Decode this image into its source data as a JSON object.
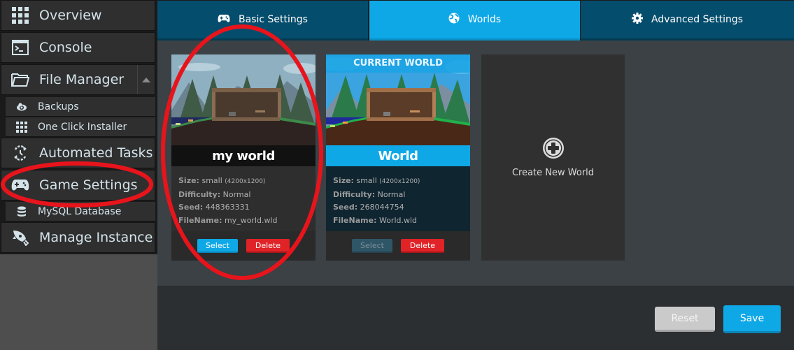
{
  "sidebar": {
    "items": [
      {
        "label": "Overview",
        "icon": "grid-icon"
      },
      {
        "label": "Console",
        "icon": "terminal-icon"
      },
      {
        "label": "File Manager",
        "icon": "folder-icon",
        "expanded": true
      },
      {
        "label": "Backups",
        "icon": "backup-cloud-icon",
        "sub": true
      },
      {
        "label": "One Click Installer",
        "icon": "grid-icon",
        "sub": true
      },
      {
        "label": "Automated Tasks",
        "icon": "task-clock-icon"
      },
      {
        "label": "Game Settings",
        "icon": "gamepad-icon"
      },
      {
        "label": "MySQL Database",
        "icon": "database-icon",
        "sub": true
      },
      {
        "label": "Manage Instance",
        "icon": "rocket-icon"
      }
    ]
  },
  "tabs": [
    {
      "label": "Basic Settings",
      "icon": "gamepad-icon",
      "active": false
    },
    {
      "label": "Worlds",
      "icon": "globe-icon",
      "active": true
    },
    {
      "label": "Advanced Settings",
      "icon": "gear-icon",
      "active": false
    }
  ],
  "worlds": [
    {
      "name": "my world",
      "current": false,
      "size_label": "Size:",
      "size": "small",
      "size_dims": "(4200x1200)",
      "difficulty_label": "Difficulty:",
      "difficulty": "Normal",
      "seed_label": "Seed:",
      "seed": "448363331",
      "filename_label": "FileName:",
      "filename": "my_world.wld",
      "select_label": "Select",
      "delete_label": "Delete"
    },
    {
      "name": "World",
      "current": true,
      "banner": "CURRENT WORLD",
      "size_label": "Size:",
      "size": "small",
      "size_dims": "(4200x1200)",
      "difficulty_label": "Difficulty:",
      "difficulty": "Normal",
      "seed_label": "Seed:",
      "seed": "268044754",
      "filename_label": "FileName:",
      "filename": "World.wld",
      "select_label": "Select",
      "delete_label": "Delete"
    }
  ],
  "create_world": {
    "label": "Create New World",
    "icon": "plus-circle-icon"
  },
  "footer": {
    "reset_label": "Reset",
    "save_label": "Save"
  },
  "colors": {
    "accent": "#0ea8e6",
    "danger": "#e02327",
    "tab_inactive": "#054d6c",
    "annotation": "#e8141c"
  }
}
